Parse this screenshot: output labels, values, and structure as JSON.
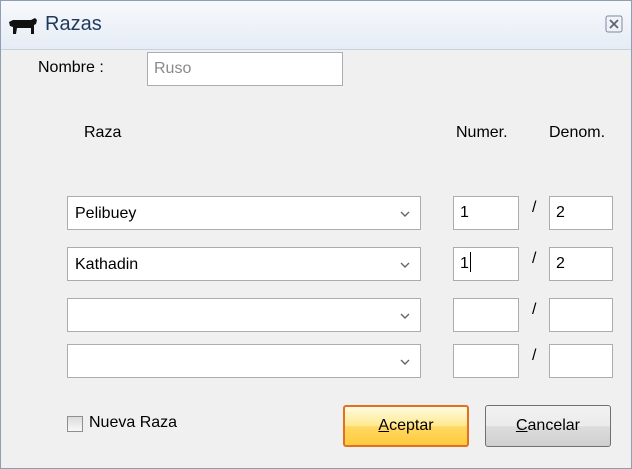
{
  "window": {
    "title": "Razas",
    "icon": "cattle-icon",
    "close_icon": "close-icon"
  },
  "form": {
    "nombre_label": "Nombre :",
    "nombre_value": "Ruso",
    "col_raza": "Raza",
    "col_numer": "Numer.",
    "col_denom": "Denom.",
    "slash": "/",
    "rows": [
      {
        "raza": "Pelibuey",
        "numer": "1",
        "denom": "2"
      },
      {
        "raza": "Kathadin",
        "numer": "1",
        "denom": "2"
      },
      {
        "raza": "",
        "numer": "",
        "denom": ""
      },
      {
        "raza": "",
        "numer": "",
        "denom": ""
      }
    ],
    "nueva_raza_label": "Nueva Raza",
    "nueva_raza_checked": false
  },
  "buttons": {
    "aceptar_first": "A",
    "aceptar_rest": "ceptar",
    "cancelar_first": "C",
    "cancelar_rest": "ancelar"
  }
}
